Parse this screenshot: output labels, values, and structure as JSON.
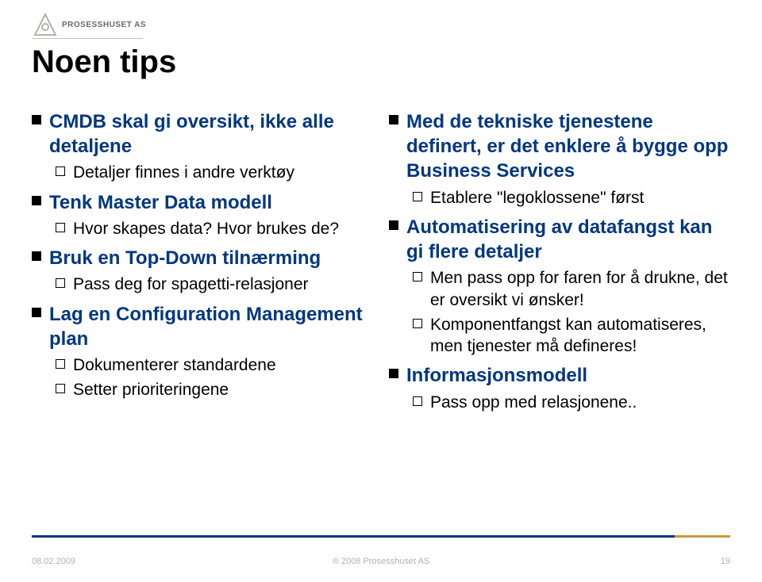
{
  "logo": {
    "text": "PROSESSHUSET AS"
  },
  "title": "Noen tips",
  "left": {
    "items": [
      {
        "level": 1,
        "text": "CMDB skal gi oversikt, ikke alle detaljene"
      },
      {
        "level": 2,
        "text": "Detaljer finnes i andre verktøy"
      },
      {
        "level": 1,
        "text": "Tenk Master Data modell"
      },
      {
        "level": 2,
        "text": "Hvor skapes data? Hvor brukes de?"
      },
      {
        "level": 1,
        "text": "Bruk en Top-Down tilnærming"
      },
      {
        "level": 2,
        "text": "Pass deg for spagetti-relasjoner"
      },
      {
        "level": 1,
        "text": "Lag en Configuration Management plan"
      },
      {
        "level": 2,
        "text": "Dokumenterer standardene"
      },
      {
        "level": 2,
        "text": "Setter prioriteringene"
      }
    ]
  },
  "right": {
    "items": [
      {
        "level": 1,
        "text": "Med de tekniske tjenestene definert, er det enklere å bygge opp Business Services"
      },
      {
        "level": 2,
        "text": "Etablere \"legoklossene\" først"
      },
      {
        "level": 1,
        "text": "Automatisering av datafangst kan gi flere detaljer"
      },
      {
        "level": 2,
        "text": "Men pass opp for faren for å drukne, det er oversikt vi ønsker!"
      },
      {
        "level": 2,
        "text": "Komponentfangst kan automatiseres, men tjenester må defineres!"
      },
      {
        "level": 1,
        "text": "Informasjonsmodell"
      },
      {
        "level": 2,
        "text": "Pass opp med relasjonene.."
      }
    ]
  },
  "footer": {
    "date": "08.02.2009",
    "copyright": "® 2008 Prosesshuset AS",
    "page": "19"
  }
}
